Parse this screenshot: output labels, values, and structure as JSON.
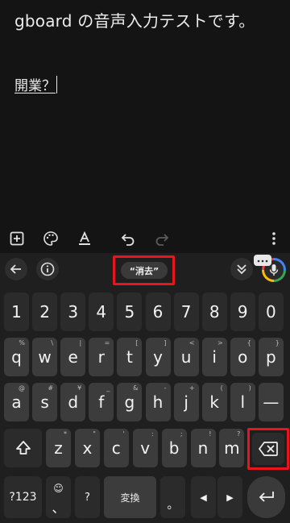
{
  "editor": {
    "title": "gboard の音声入力テストです。",
    "typed": "開業？"
  },
  "edit_toolbar": {
    "icons": [
      "add-box-icon",
      "palette-icon",
      "text-format-icon",
      "undo-icon",
      "redo-icon",
      "more-vert-icon"
    ]
  },
  "keyboard_toolbar": {
    "suggestion": "“消去”",
    "icons": [
      "back-arrow-icon",
      "info-icon",
      "collapse-icon",
      "mic-icon"
    ]
  },
  "number_row": [
    "1",
    "2",
    "3",
    "4",
    "5",
    "6",
    "7",
    "8",
    "9",
    "0"
  ],
  "row1": [
    {
      "main": "q",
      "hint": "%"
    },
    {
      "main": "w",
      "hint": "\\"
    },
    {
      "main": "e",
      "hint": "|"
    },
    {
      "main": "r",
      "hint": "="
    },
    {
      "main": "t",
      "hint": "["
    },
    {
      "main": "y",
      "hint": "]"
    },
    {
      "main": "u",
      "hint": "<"
    },
    {
      "main": "i",
      "hint": ">"
    },
    {
      "main": "o",
      "hint": "{"
    },
    {
      "main": "p",
      "hint": "}"
    }
  ],
  "row2": [
    {
      "main": "a",
      "hint": "@"
    },
    {
      "main": "s",
      "hint": "#"
    },
    {
      "main": "d",
      "hint": "¥"
    },
    {
      "main": "f",
      "hint": "_"
    },
    {
      "main": "g",
      "hint": "&"
    },
    {
      "main": "h",
      "hint": "-"
    },
    {
      "main": "j",
      "hint": "+"
    },
    {
      "main": "k",
      "hint": "("
    },
    {
      "main": "l",
      "hint": ")"
    },
    {
      "main": "—",
      "hint": ""
    }
  ],
  "row3": [
    {
      "main": "z",
      "hint": "*"
    },
    {
      "main": "x",
      "hint": "\""
    },
    {
      "main": "c",
      "hint": "'"
    },
    {
      "main": "v",
      "hint": ":"
    },
    {
      "main": "b",
      "hint": ";"
    },
    {
      "main": "n",
      "hint": "!"
    },
    {
      "main": "m",
      "hint": "?"
    }
  ],
  "bottom_row": {
    "sym": "?123",
    "emoji_top": "☺",
    "emoji_bottom": "、",
    "question": "?",
    "convert": "変換",
    "period": "。",
    "left": "◀",
    "right": "▶"
  },
  "colors": {
    "highlight": "#e8161c",
    "key": "#3c3c3c",
    "background": "#1f1f1f"
  }
}
